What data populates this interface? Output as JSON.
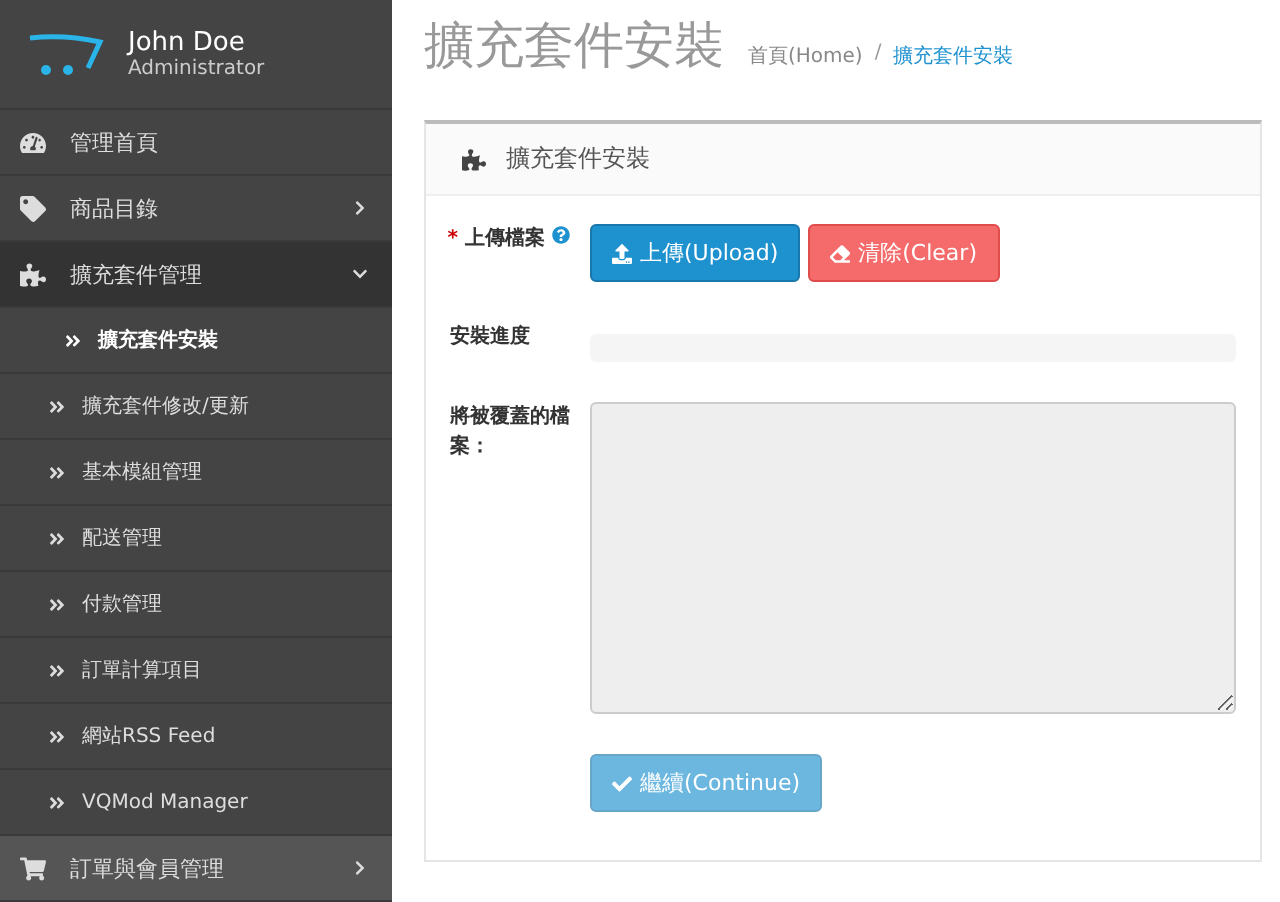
{
  "user": {
    "name": "John Doe",
    "role": "Administrator"
  },
  "menu": [
    {
      "label": "管理首頁",
      "has_children": false,
      "expanded": false
    },
    {
      "label": "商品目錄",
      "has_children": true,
      "expanded": false
    },
    {
      "label": "擴充套件管理",
      "has_children": true,
      "expanded": true,
      "children": [
        {
          "label": "擴充套件安裝",
          "selected": true
        },
        {
          "label": "擴充套件修改/更新",
          "selected": false
        },
        {
          "label": "基本模組管理",
          "selected": false
        },
        {
          "label": "配送管理",
          "selected": false
        },
        {
          "label": "付款管理",
          "selected": false
        },
        {
          "label": "訂單計算項目",
          "selected": false
        },
        {
          "label": "網站RSS Feed",
          "selected": false
        },
        {
          "label": "VQMod Manager",
          "selected": false
        }
      ]
    },
    {
      "label": "訂單與會員管理",
      "has_children": true,
      "expanded": false
    }
  ],
  "page_title": "擴充套件安裝",
  "breadcrumb_separator": "/",
  "breadcrumb": [
    {
      "label": "首頁(Home)",
      "current": false
    },
    {
      "label": "擴充套件安裝",
      "current": true
    }
  ],
  "panel": {
    "title": "擴充套件安裝",
    "required_mark": "*",
    "upload_label": "上傳檔案",
    "upload_button": "上傳(Upload)",
    "clear_button": "清除(Clear)",
    "progress_label": "安裝進度",
    "progress": {
      "level": 0
    },
    "overwrite_label": "將被覆蓋的檔案：",
    "continue_button": {
      "label": "繼續(Continue)",
      "disabled": true
    }
  }
}
